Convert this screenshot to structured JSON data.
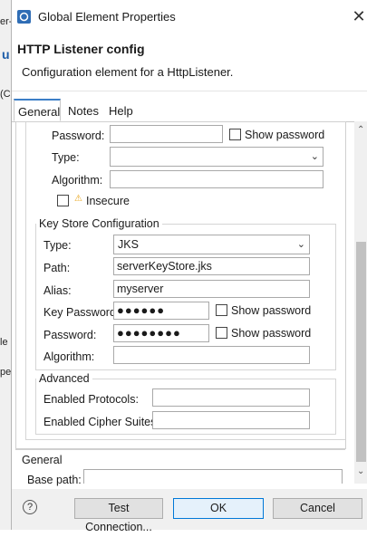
{
  "background": {
    "texts": [
      "er-",
      "u",
      "(C",
      "le",
      "pe"
    ]
  },
  "window": {
    "title": "Global Element Properties",
    "close_glyph": "✕"
  },
  "header": {
    "title": "HTTP Listener config",
    "description": "Configuration element for a HttpListener."
  },
  "tabs": [
    {
      "label": "General",
      "active": true
    },
    {
      "label": "Notes"
    },
    {
      "label": "Help"
    }
  ],
  "trust_store": {
    "password_label": "Password:",
    "password_value": "",
    "show_password": "Show password",
    "type_label": "Type:",
    "type_value": "",
    "algorithm_label": "Algorithm:",
    "algorithm_value": "",
    "insecure_label": "Insecure"
  },
  "key_store": {
    "group_title": "Key Store Configuration",
    "type_label": "Type:",
    "type_value": "JKS",
    "path_label": "Path:",
    "path_value": "serverKeyStore.jks",
    "alias_label": "Alias:",
    "alias_value": "myserver",
    "key_password_label": "Key Password:",
    "key_password_value": "●●●●●●",
    "key_show_password": "Show password",
    "password_label": "Password:",
    "password_value": "●●●●●●●●",
    "show_password": "Show password",
    "algorithm_label": "Algorithm:",
    "algorithm_value": ""
  },
  "advanced": {
    "group_title": "Advanced",
    "protocols_label": "Enabled Protocols:",
    "protocols_value": "",
    "cipher_label": "Enabled Cipher Suites:",
    "cipher_value": ""
  },
  "general_section": {
    "title": "General",
    "base_path_label": "Base path:"
  },
  "footer": {
    "test_label": "Test Connection...",
    "ok_label": "OK",
    "cancel_label": "Cancel",
    "help_glyph": "?"
  },
  "colors": {
    "accent": "#0078d7",
    "tab_accent": "#3c7fc7",
    "warning": "#e8a317"
  }
}
